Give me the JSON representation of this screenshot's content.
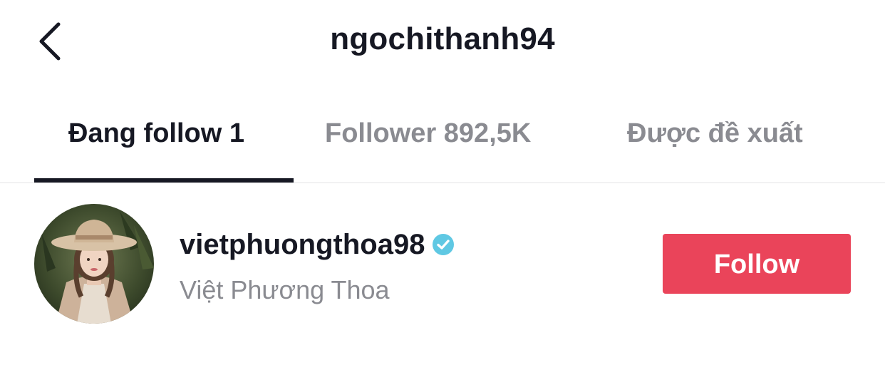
{
  "header": {
    "back_icon": "chevron-left-icon",
    "title": "ngochithanh94"
  },
  "tabs": [
    {
      "label": "Đang follow 1",
      "active": true
    },
    {
      "label": "Follower 892,5K",
      "active": false
    },
    {
      "label": "Được đề xuất",
      "active": false
    }
  ],
  "users": [
    {
      "username": "vietphuongthoa98",
      "verified": true,
      "verified_icon": "verified-badge-icon",
      "nickname": "Việt Phương Thoa",
      "button_label": "Follow"
    }
  ],
  "colors": {
    "primary_text": "#161823",
    "secondary_text": "#8a8b91",
    "follow_button": "#ea445a",
    "verified_badge": "#5fc8e3"
  }
}
